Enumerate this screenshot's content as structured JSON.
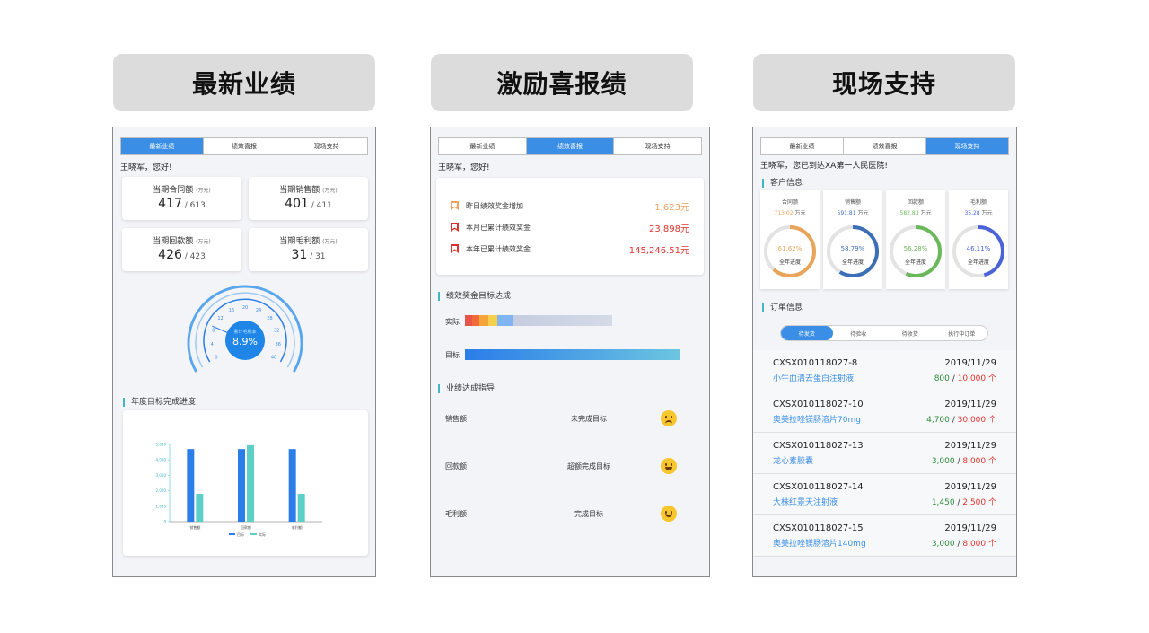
{
  "headers": [
    "最新业绩",
    "激励喜报绩",
    "现场支持"
  ],
  "tabs": [
    "最新业绩",
    "绩效喜报",
    "现场支持"
  ],
  "panel1": {
    "greeting": "王晓军，您好!",
    "kpis": [
      {
        "label": "当期合同额",
        "unit": "(万元)",
        "value": "417",
        "target": "613"
      },
      {
        "label": "当期销售额",
        "unit": "(万元)",
        "value": "401",
        "target": "411"
      },
      {
        "label": "当期回款额",
        "unit": "(万元)",
        "value": "426",
        "target": "423"
      },
      {
        "label": "当期毛利额",
        "unit": "(万元)",
        "value": "31",
        "target": "31"
      }
    ],
    "gauge": {
      "label": "累计毛利率",
      "value": "8.9%",
      "ticks": [
        "0",
        "4",
        "8",
        "12",
        "16",
        "20",
        "24",
        "28",
        "32",
        "36",
        "40"
      ],
      "percent": 8.9,
      "max": 40
    },
    "section_title": "年度目标完成进度",
    "chart_data": {
      "type": "bar",
      "categories": [
        "销售额",
        "回款额",
        "毛利额"
      ],
      "series": [
        {
          "name": "目标",
          "values": [
            4700,
            4700,
            4700
          ],
          "color": "#2b7de9"
        },
        {
          "name": "实际",
          "values": [
            1800,
            4950,
            1800
          ],
          "color": "#5ccfc6"
        }
      ],
      "yticks": [
        "0",
        "1,000",
        "2,000",
        "3,000",
        "4,000",
        "5,000"
      ],
      "ylim": [
        0,
        5000
      ],
      "legend": "bottom"
    }
  },
  "panel2": {
    "greeting": "王晓军，您好!",
    "rewards": [
      {
        "label": "昨日绩效奖金增加",
        "value": "1,623元",
        "color": "#f0a060"
      },
      {
        "label": "本月已累计绩效奖金",
        "value": "23,898元",
        "color": "#e0332d"
      },
      {
        "label": "本年已累计绩效奖金",
        "value": "145,246.51元",
        "color": "#e0332d"
      }
    ],
    "target_title": "绩效奖金目标达成",
    "actual_label": "实际",
    "target_label": "目标",
    "perf_title": "业绩达成指导",
    "perf_rows": [
      {
        "metric": "销售额",
        "status": "未完成目标",
        "mood": "sad"
      },
      {
        "metric": "回款额",
        "status": "超额完成目标",
        "mood": "happy"
      },
      {
        "metric": "毛利额",
        "status": "完成目标",
        "mood": "smile"
      }
    ]
  },
  "panel3": {
    "greeting": "王晓军，您已到达XA第一人民医院!",
    "cust_title": "客户信息",
    "cust_cards": [
      {
        "label": "合同额",
        "value": "713.02",
        "unit": "万元",
        "pct": "61.62%",
        "progress": 0.6162,
        "plabel": "全年进度",
        "color": "#e8a55a"
      },
      {
        "label": "销售额",
        "value": "591.81",
        "unit": "万元",
        "pct": "58.79%",
        "progress": 0.5879,
        "plabel": "全年进度",
        "color": "#3d6fb6"
      },
      {
        "label": "回款额",
        "value": "582.83",
        "unit": "万元",
        "pct": "56.28%",
        "progress": 0.5628,
        "plabel": "全年进度",
        "color": "#6bb85a"
      },
      {
        "label": "毛利额",
        "value": "35.28",
        "unit": "万元",
        "pct": "46.11%",
        "progress": 0.4611,
        "plabel": "全年进度",
        "color": "#4a63d9"
      }
    ],
    "order_title": "订单信息",
    "segments": [
      "待发货",
      "待验收",
      "待收货",
      "执行中订单"
    ],
    "orders": [
      {
        "id": "CXSX010118027-8",
        "date": "2019/11/29",
        "name": "小牛血清去蛋白注射液",
        "done": "800",
        "total": "10,000 个"
      },
      {
        "id": "CXSX010118027-10",
        "date": "2019/11/29",
        "name": "奥美拉唑镁肠溶片70mg",
        "done": "4,700",
        "total": "30,000 个"
      },
      {
        "id": "CXSX010118027-13",
        "date": "2019/11/29",
        "name": "龙心素胶囊",
        "done": "3,000",
        "total": "8,000 个"
      },
      {
        "id": "CXSX010118027-14",
        "date": "2019/11/29",
        "name": "大株红景天注射液",
        "done": "1,450",
        "total": "2,500 个"
      },
      {
        "id": "CXSX010118027-15",
        "date": "2019/11/29",
        "name": "奥美拉唑镁肠溶片140mg",
        "done": "3,000",
        "total": "8,000 个"
      }
    ]
  }
}
